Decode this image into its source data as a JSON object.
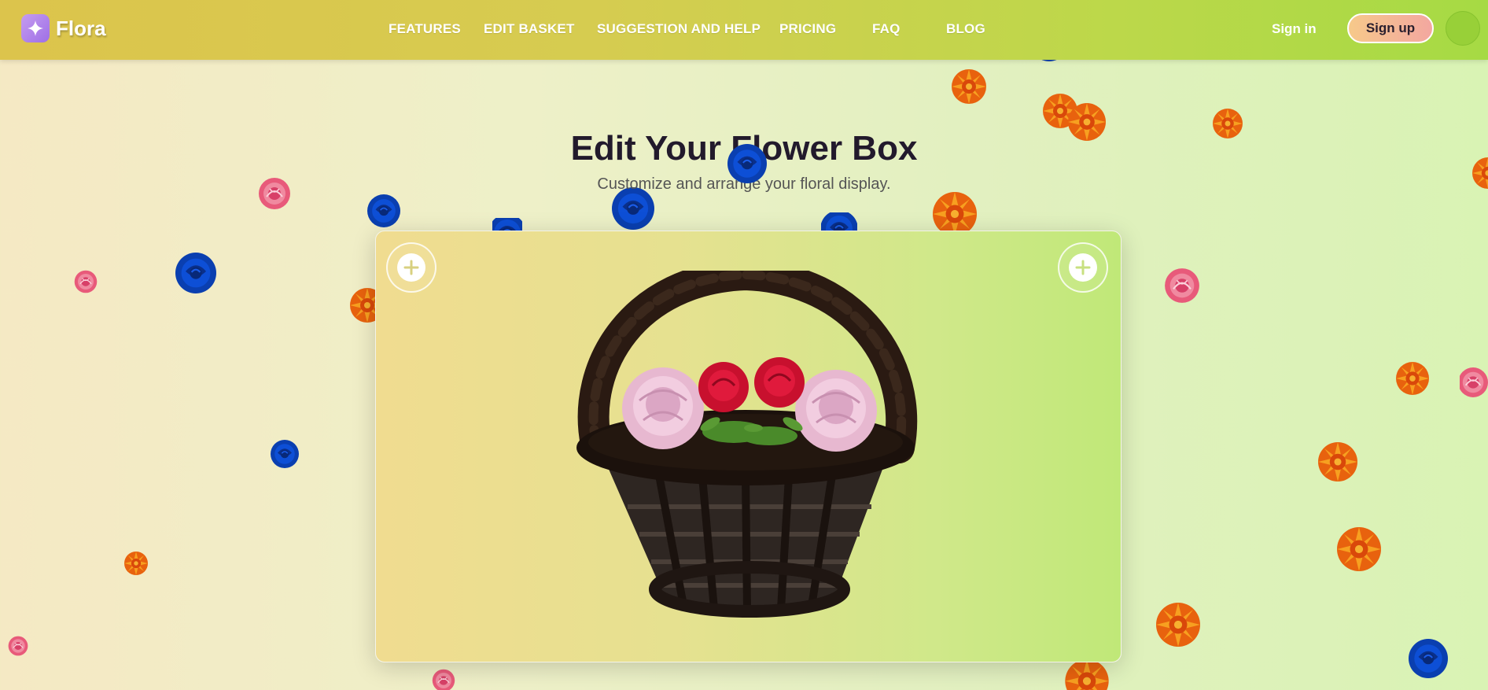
{
  "brand": {
    "name": "Flora",
    "icon": "sparkle-icon"
  },
  "nav": {
    "links": [
      "FEATURES",
      "EDIT BASKET",
      "SUGGESTION AND HELP",
      "PRICING",
      "FAQ",
      "BLOG"
    ],
    "sign_in": "Sign in",
    "sign_up": "Sign up"
  },
  "hero": {
    "title": "Edit Your Flower Box",
    "subtitle": "Customize and arrange your floral display."
  },
  "editor": {
    "left_button_icon": "plus-icon",
    "right_button_icon": "plus-icon",
    "scene": "flower-basket-3d"
  },
  "colors": {
    "nav_start": "#dcc44c",
    "nav_end": "#a6da44",
    "title": "#221a2c",
    "sign_up_gradient": [
      "#f6c98a",
      "#f3a7a0"
    ]
  }
}
